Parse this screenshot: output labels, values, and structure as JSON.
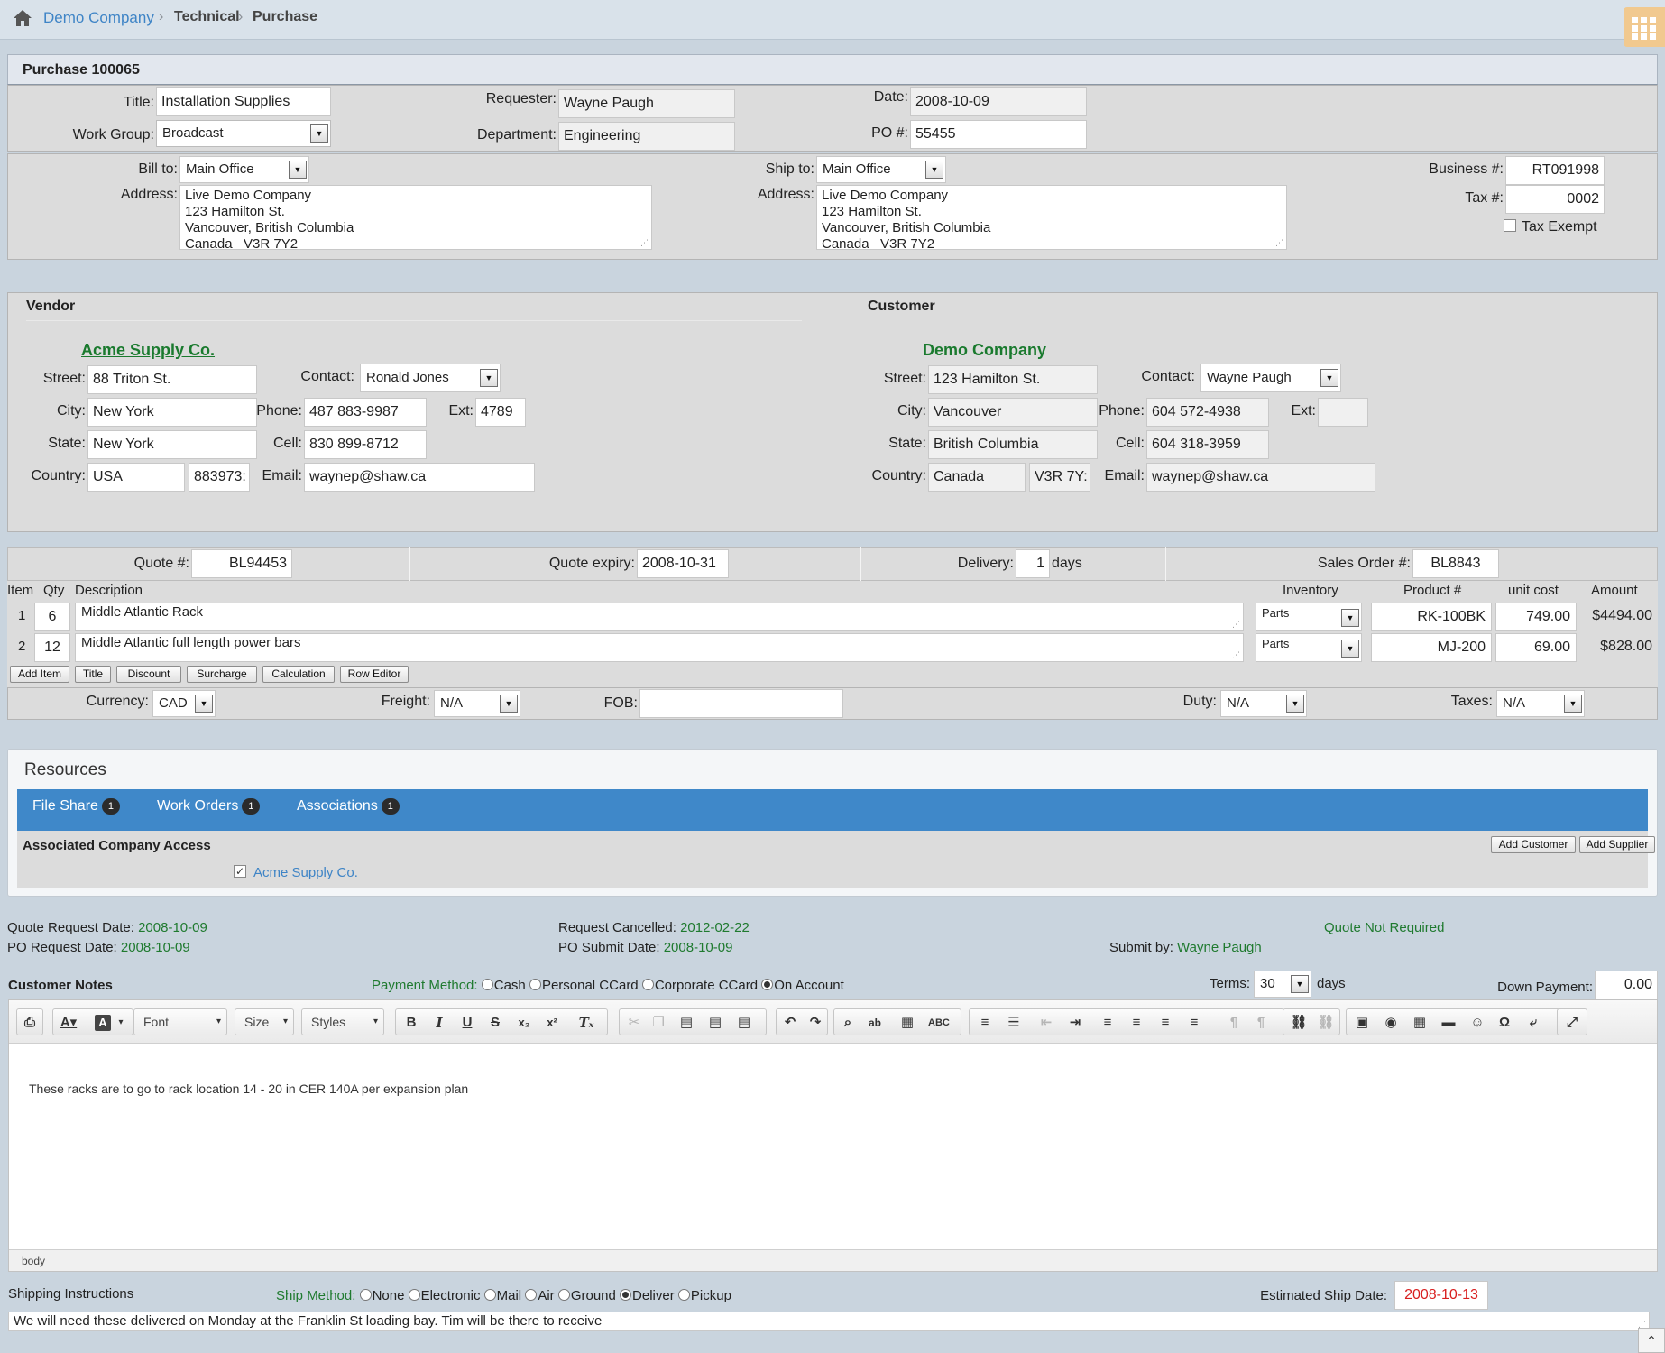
{
  "breadcrumb": {
    "home": "Demo Company",
    "section": "Technical",
    "current": "Purchase"
  },
  "purchase": {
    "title_bar": "Purchase 100065",
    "title_label": "Title:",
    "title_value": "Installation Supplies",
    "workgroup_label": "Work Group:",
    "workgroup_value": "Broadcast",
    "requester_label": "Requester:",
    "requester_value": "Wayne Paugh",
    "department_label": "Department:",
    "department_value": "Engineering",
    "date_label": "Date:",
    "date_value": "2008-10-09",
    "po_label": "PO #:",
    "po_value": "55455"
  },
  "billing": {
    "bill_to_label": "Bill to:",
    "bill_to_value": "Main Office",
    "bill_address_label": "Address:",
    "bill_address": [
      "Live Demo Company",
      "123 Hamilton St.",
      "Vancouver, British Columbia",
      "Canada   V3R 7Y2"
    ],
    "ship_to_label": "Ship to:",
    "ship_to_value": "Main Office",
    "ship_address_label": "Address:",
    "ship_address": [
      "Live Demo Company",
      "123 Hamilton St.",
      "Vancouver, British Columbia",
      "Canada   V3R 7Y2"
    ],
    "business_label": "Business #:",
    "business_value": "RT091998",
    "tax_label": "Tax #:",
    "tax_value": "0002",
    "tax_exempt_label": "Tax Exempt"
  },
  "vendor": {
    "heading": "Vendor",
    "name": "Acme Supply Co.",
    "street_label": "Street:",
    "street": "88 Triton St.",
    "city_label": "City:",
    "city": "New York",
    "state_label": "State:",
    "state": "New York",
    "country_label": "Country:",
    "country": "USA",
    "postal": "883973:",
    "contact_label": "Contact:",
    "contact": "Ronald Jones",
    "phone_label": "Phone:",
    "phone": "487 883-9987",
    "ext_label": "Ext:",
    "ext": "4789",
    "cell_label": "Cell:",
    "cell": "830 899-8712",
    "email_label": "Email:",
    "email": "waynep@shaw.ca"
  },
  "customer": {
    "heading": "Customer",
    "name": "Demo Company",
    "street_label": "Street:",
    "street": "123 Hamilton St.",
    "city_label": "City:",
    "city": "Vancouver",
    "state_label": "State:",
    "state": "British Columbia",
    "country_label": "Country:",
    "country": "Canada",
    "postal": "V3R 7Y:",
    "contact_label": "Contact:",
    "contact": "Wayne Paugh",
    "phone_label": "Phone:",
    "phone": "604 572-4938",
    "ext_label": "Ext:",
    "ext": "",
    "cell_label": "Cell:",
    "cell": "604 318-3959",
    "email_label": "Email:",
    "email": "waynep@shaw.ca"
  },
  "quote": {
    "quote_label": "Quote #:",
    "quote_value": "BL94453",
    "expiry_label": "Quote expiry:",
    "expiry_value": "2008-10-31",
    "delivery_label": "Delivery:",
    "delivery_value": "1",
    "delivery_unit": "days",
    "sales_order_label": "Sales Order #:",
    "sales_order_value": "BL8843"
  },
  "items": {
    "headers": {
      "item": "Item",
      "qty": "Qty",
      "description": "Description",
      "inventory": "Inventory",
      "product": "Product #",
      "unit_cost": "unit cost",
      "amount": "Amount"
    },
    "rows": [
      {
        "item": "1",
        "qty": "6",
        "description": "Middle Atlantic Rack",
        "inventory": "Parts",
        "product": "RK-100BK",
        "unit_cost": "749.00",
        "amount": "$4494.00"
      },
      {
        "item": "2",
        "qty": "12",
        "description": "Middle Atlantic full length power bars",
        "inventory": "Parts",
        "product": "MJ-200",
        "unit_cost": "69.00",
        "amount": "$828.00"
      }
    ],
    "buttons": [
      "Add Item",
      "Title",
      "Discount",
      "Surcharge",
      "Calculation",
      "Row Editor"
    ]
  },
  "totals": {
    "currency_label": "Currency:",
    "currency_value": "CAD",
    "freight_label": "Freight:",
    "freight_value": "N/A",
    "fob_label": "FOB:",
    "fob_value": "",
    "duty_label": "Duty:",
    "duty_value": "N/A",
    "taxes_label": "Taxes:",
    "taxes_value": "N/A"
  },
  "resources": {
    "heading": "Resources",
    "tabs": [
      {
        "label": "File Share",
        "count": "1"
      },
      {
        "label": "Work Orders",
        "count": "1"
      },
      {
        "label": "Associations",
        "count": "1"
      }
    ],
    "access_heading": "Associated Company Access",
    "add_customer": "Add Customer",
    "add_supplier": "Add Supplier",
    "company": "Acme Supply Co."
  },
  "dates": {
    "quote_request_label": "Quote Request Date:",
    "quote_request_value": "2008-10-09",
    "po_request_label": "PO Request Date:",
    "po_request_value": "2008-10-09",
    "cancelled_label": "Request Cancelled:",
    "cancelled_value": "2012-02-22",
    "po_submit_label": "PO Submit Date:",
    "po_submit_value": "2008-10-09",
    "quote_not_required": "Quote Not Required",
    "submit_by_label": "Submit by:",
    "submit_by_value": "Wayne Paugh"
  },
  "notes": {
    "heading": "Customer Notes",
    "payment_label": "Payment Method:",
    "payment_options": [
      "Cash",
      "Personal CCard",
      "Corporate CCard",
      "On Account"
    ],
    "payment_selected": "On Account",
    "terms_label": "Terms:",
    "terms_value": "30",
    "terms_unit": "days",
    "down_label": "Down Payment:",
    "down_value": "0.00",
    "editor_font": "Font",
    "editor_size": "Size",
    "editor_styles": "Styles",
    "body": "These racks are to go to rack location 14 - 20 in CER 140A per expansion plan",
    "status_path": "body"
  },
  "shipping": {
    "heading": "Shipping Instructions",
    "method_label": "Ship Method:",
    "methods": [
      "None",
      "Electronic",
      "Mail",
      "Air",
      "Ground",
      "Deliver",
      "Pickup"
    ],
    "method_selected": "Deliver",
    "est_label": "Estimated Ship Date:",
    "est_value": "2008-10-13",
    "instructions": "We will need these delivered on Monday at the Franklin St loading bay. Tim will be there to receive"
  },
  "colors": {
    "accent": "#3f88c9",
    "green": "#1f7a2f",
    "red": "#d81f1f",
    "page_bg": "#c9d4de"
  }
}
